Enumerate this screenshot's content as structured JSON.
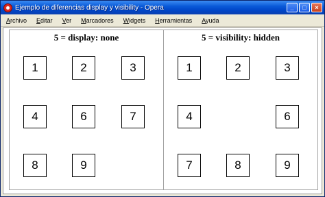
{
  "window": {
    "title": "Ejemplo de diferencias display y visibility - Opera"
  },
  "menu": [
    "Archivo",
    "Editar",
    "Ver",
    "Marcadores",
    "Widgets",
    "Herramientas",
    "Ayuda"
  ],
  "controls": {
    "minimize": "_",
    "maximize": "□",
    "close": "×"
  },
  "left_panel": {
    "title": "5 = display: none",
    "boxes": [
      "1",
      "2",
      "3",
      "4",
      "6",
      "7",
      "8",
      "9"
    ]
  },
  "right_panel": {
    "title": "5 = visibility: hidden",
    "boxes": [
      "1",
      "2",
      "3",
      "4",
      "6",
      "7",
      "8",
      "9"
    ]
  }
}
